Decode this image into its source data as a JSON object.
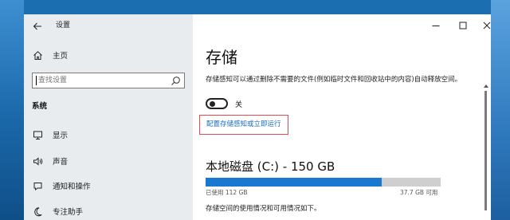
{
  "window": {
    "title": "设置",
    "controls": {
      "minimize": "minimize",
      "maximize": "maximize",
      "close": "close"
    }
  },
  "sidebar": {
    "home_label": "主页",
    "search_placeholder": "查找设置",
    "section_label": "系统",
    "items": [
      {
        "label": "显示",
        "icon": "display-icon"
      },
      {
        "label": "声音",
        "icon": "speaker-icon"
      },
      {
        "label": "通知和操作",
        "icon": "notification-icon"
      },
      {
        "label": "专注助手",
        "icon": "focus-moon-icon"
      }
    ]
  },
  "main": {
    "title": "存储",
    "description": "存储感知可以通过删除不需要的文件(例如临时文件和回收站中的内容)自动释放空间。",
    "toggle": {
      "state": "off",
      "label": "关"
    },
    "config_link": "配置存储感知或立即运行",
    "disk": {
      "title": "本地磁盘 (C:) - 150 GB",
      "used_text": "已使用 112 GB",
      "free_text": "37.7 GB 可用",
      "used_fraction": 0.75,
      "usage_description": "存储空间的使用情况和可用情况如下。"
    }
  },
  "colors": {
    "accent": "#1978cf",
    "link": "#1a6fc9",
    "highlight_box": "#e8474f",
    "sidebar_bg": "#e9ecef",
    "bar_track": "#cfcfcf"
  }
}
